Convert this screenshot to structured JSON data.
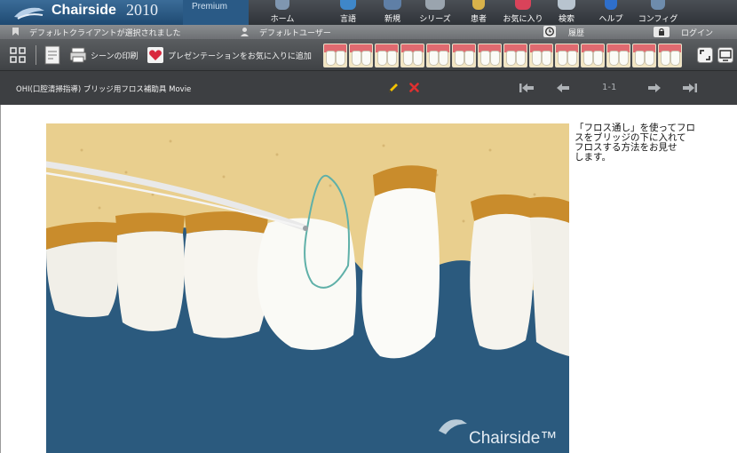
{
  "app": {
    "brand_name": "Chairside",
    "brand_year": "2010",
    "edition": "Premium"
  },
  "nav": {
    "items": [
      {
        "label": "ホーム",
        "icon": "dental-chair-icon"
      },
      {
        "label": "言語",
        "icon": "globe-icon"
      },
      {
        "label": "新規",
        "icon": "new-icon"
      },
      {
        "label": "シリーズ",
        "icon": "film-icon"
      },
      {
        "label": "患者",
        "icon": "patient-icon"
      },
      {
        "label": "お気に入り",
        "icon": "heart-icon"
      },
      {
        "label": "検索",
        "icon": "search-icon"
      },
      {
        "label": "ヘルプ",
        "icon": "help-icon"
      },
      {
        "label": "コンフィグ",
        "icon": "gear-icon"
      }
    ]
  },
  "status": {
    "client": "デフォルトクライアントが選択されました",
    "user": "デフォルトユーザー",
    "history": "履歴",
    "login": "ログイン"
  },
  "toolbar": {
    "print_scene": "シーンの印刷",
    "add_presentation_favorite": "プレゼンテーションをお気に入りに追加"
  },
  "header": {
    "title": "OHI(口腔清掃指導) ブリッジ用フロス補助具 Movie",
    "page": "1-1"
  },
  "content": {
    "description_lines": [
      "「フロス通し」を使ってフロ",
      "スをブリッジの下に入れて",
      "フロスする方法をお見せ",
      "します。"
    ],
    "watermark": "Chairside™"
  },
  "colors": {
    "brand_blue": "#2a5a86",
    "video_background": "#2b5a7e",
    "gum": "#e9cf8e",
    "gold": "#c98c2c",
    "accent_pencil": "#f2c200",
    "accent_delete": "#e03030"
  }
}
